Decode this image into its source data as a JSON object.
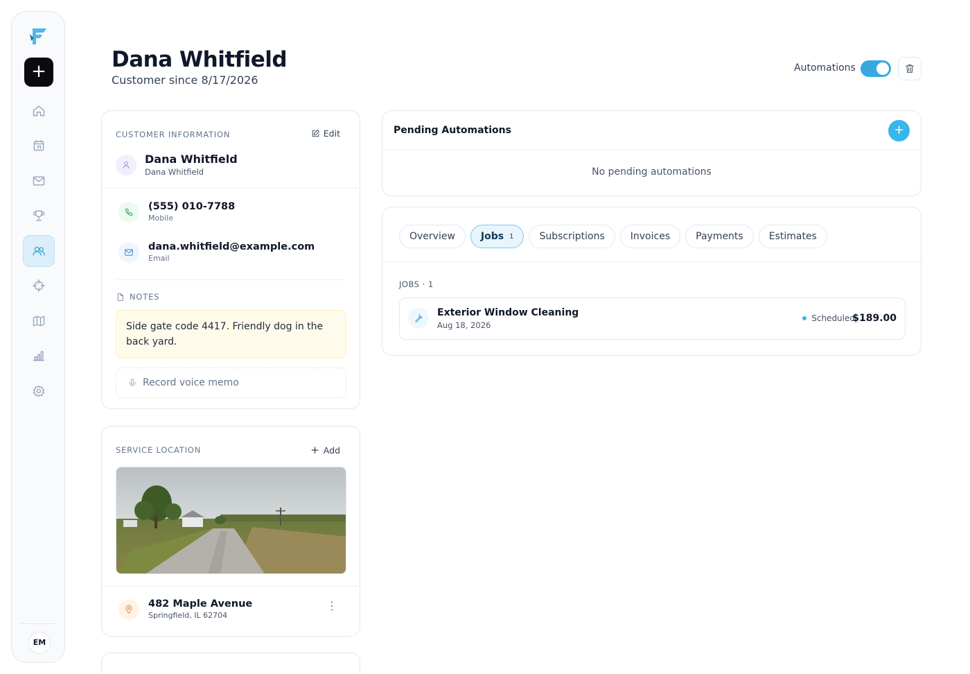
{
  "header": {
    "title": "Dana Whitfield",
    "subtitle": "Customer since 8/17/2026",
    "automations_label": "Automations",
    "automations_enabled": true
  },
  "sidebar": {
    "avatar_initials": "EM",
    "new_button": "+",
    "items": [
      {
        "icon": "home-icon"
      },
      {
        "icon": "calendar-icon"
      },
      {
        "icon": "mail-icon"
      },
      {
        "icon": "trophy-icon"
      },
      {
        "icon": "users-icon",
        "active": true
      },
      {
        "icon": "crosshair-icon"
      },
      {
        "icon": "map-icon"
      },
      {
        "icon": "bar-chart-icon"
      },
      {
        "icon": "settings-icon"
      }
    ],
    "accent_color": "#38a8d8"
  },
  "customer_info": {
    "section_label": "CUSTOMER INFORMATION",
    "edit_label": "Edit",
    "name": "Dana Whitfield",
    "name_sub": "Dana Whitfield",
    "phone": "(555) 010-7788",
    "phone_type": "Mobile",
    "email": "dana.whitfield@example.com",
    "email_type": "Email",
    "notes_label": "NOTES",
    "notes_text": "Side gate code 4417. Friendly dog in the back yard.",
    "voice_memo_label": "Record voice memo"
  },
  "service_location": {
    "section_label": "SERVICE LOCATION",
    "add_label": "Add",
    "street": "482 Maple Avenue",
    "city_line": "Springfield, IL 62704"
  },
  "pending_automations": {
    "title": "Pending Automations",
    "empty_text": "No pending automations"
  },
  "tabs": [
    {
      "label": "Overview"
    },
    {
      "label": "Jobs",
      "count": "1",
      "active": true
    },
    {
      "label": "Subscriptions"
    },
    {
      "label": "Invoices"
    },
    {
      "label": "Payments"
    },
    {
      "label": "Estimates"
    }
  ],
  "jobs": {
    "label": "JOBS · 1",
    "items": [
      {
        "title": "Exterior Window Cleaning",
        "date": "Aug 18, 2026",
        "status": "Scheduled",
        "price": "$189.00"
      }
    ]
  }
}
